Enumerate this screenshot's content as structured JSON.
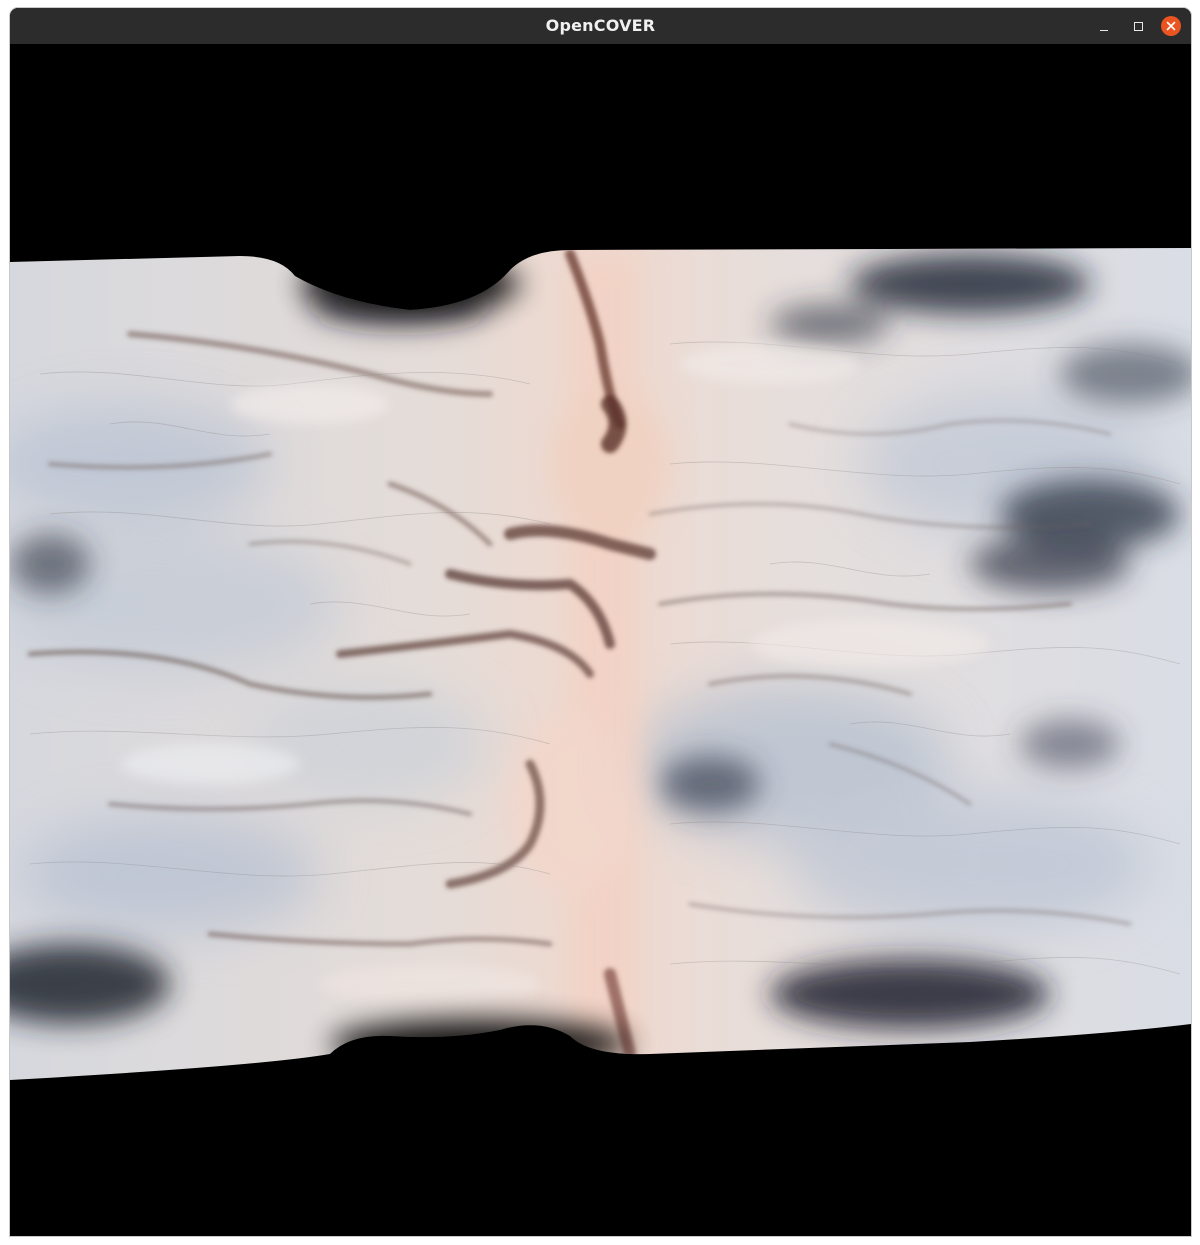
{
  "window": {
    "title": "OpenCOVER",
    "controls": {
      "minimize_icon": "minimize-icon",
      "maximize_icon": "maximize-icon",
      "close_icon": "close-icon",
      "close_color": "#e95420"
    }
  },
  "viewport": {
    "background_color": "#000000",
    "content": "volume-render-flow"
  }
}
